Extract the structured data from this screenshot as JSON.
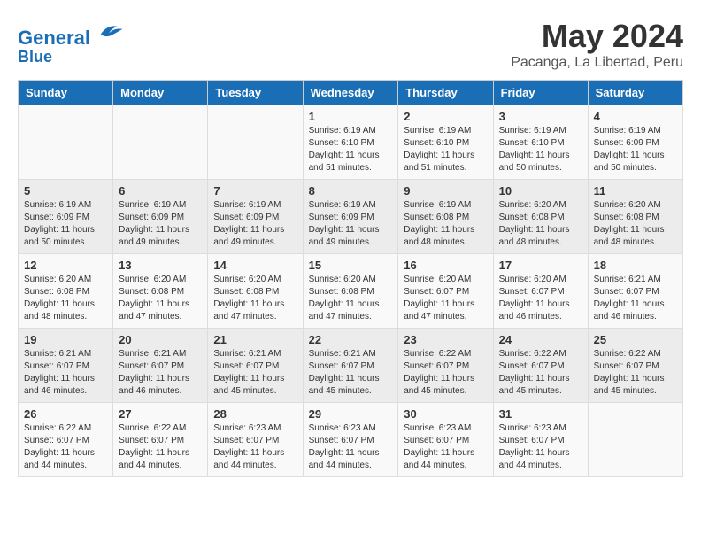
{
  "header": {
    "logo_line1": "General",
    "logo_line2": "Blue",
    "month_year": "May 2024",
    "location": "Pacanga, La Libertad, Peru"
  },
  "days_of_week": [
    "Sunday",
    "Monday",
    "Tuesday",
    "Wednesday",
    "Thursday",
    "Friday",
    "Saturday"
  ],
  "weeks": [
    [
      {
        "day": "",
        "info": ""
      },
      {
        "day": "",
        "info": ""
      },
      {
        "day": "",
        "info": ""
      },
      {
        "day": "1",
        "info": "Sunrise: 6:19 AM\nSunset: 6:10 PM\nDaylight: 11 hours\nand 51 minutes."
      },
      {
        "day": "2",
        "info": "Sunrise: 6:19 AM\nSunset: 6:10 PM\nDaylight: 11 hours\nand 51 minutes."
      },
      {
        "day": "3",
        "info": "Sunrise: 6:19 AM\nSunset: 6:10 PM\nDaylight: 11 hours\nand 50 minutes."
      },
      {
        "day": "4",
        "info": "Sunrise: 6:19 AM\nSunset: 6:09 PM\nDaylight: 11 hours\nand 50 minutes."
      }
    ],
    [
      {
        "day": "5",
        "info": "Sunrise: 6:19 AM\nSunset: 6:09 PM\nDaylight: 11 hours\nand 50 minutes."
      },
      {
        "day": "6",
        "info": "Sunrise: 6:19 AM\nSunset: 6:09 PM\nDaylight: 11 hours\nand 49 minutes."
      },
      {
        "day": "7",
        "info": "Sunrise: 6:19 AM\nSunset: 6:09 PM\nDaylight: 11 hours\nand 49 minutes."
      },
      {
        "day": "8",
        "info": "Sunrise: 6:19 AM\nSunset: 6:09 PM\nDaylight: 11 hours\nand 49 minutes."
      },
      {
        "day": "9",
        "info": "Sunrise: 6:19 AM\nSunset: 6:08 PM\nDaylight: 11 hours\nand 48 minutes."
      },
      {
        "day": "10",
        "info": "Sunrise: 6:20 AM\nSunset: 6:08 PM\nDaylight: 11 hours\nand 48 minutes."
      },
      {
        "day": "11",
        "info": "Sunrise: 6:20 AM\nSunset: 6:08 PM\nDaylight: 11 hours\nand 48 minutes."
      }
    ],
    [
      {
        "day": "12",
        "info": "Sunrise: 6:20 AM\nSunset: 6:08 PM\nDaylight: 11 hours\nand 48 minutes."
      },
      {
        "day": "13",
        "info": "Sunrise: 6:20 AM\nSunset: 6:08 PM\nDaylight: 11 hours\nand 47 minutes."
      },
      {
        "day": "14",
        "info": "Sunrise: 6:20 AM\nSunset: 6:08 PM\nDaylight: 11 hours\nand 47 minutes."
      },
      {
        "day": "15",
        "info": "Sunrise: 6:20 AM\nSunset: 6:08 PM\nDaylight: 11 hours\nand 47 minutes."
      },
      {
        "day": "16",
        "info": "Sunrise: 6:20 AM\nSunset: 6:07 PM\nDaylight: 11 hours\nand 47 minutes."
      },
      {
        "day": "17",
        "info": "Sunrise: 6:20 AM\nSunset: 6:07 PM\nDaylight: 11 hours\nand 46 minutes."
      },
      {
        "day": "18",
        "info": "Sunrise: 6:21 AM\nSunset: 6:07 PM\nDaylight: 11 hours\nand 46 minutes."
      }
    ],
    [
      {
        "day": "19",
        "info": "Sunrise: 6:21 AM\nSunset: 6:07 PM\nDaylight: 11 hours\nand 46 minutes."
      },
      {
        "day": "20",
        "info": "Sunrise: 6:21 AM\nSunset: 6:07 PM\nDaylight: 11 hours\nand 46 minutes."
      },
      {
        "day": "21",
        "info": "Sunrise: 6:21 AM\nSunset: 6:07 PM\nDaylight: 11 hours\nand 45 minutes."
      },
      {
        "day": "22",
        "info": "Sunrise: 6:21 AM\nSunset: 6:07 PM\nDaylight: 11 hours\nand 45 minutes."
      },
      {
        "day": "23",
        "info": "Sunrise: 6:22 AM\nSunset: 6:07 PM\nDaylight: 11 hours\nand 45 minutes."
      },
      {
        "day": "24",
        "info": "Sunrise: 6:22 AM\nSunset: 6:07 PM\nDaylight: 11 hours\nand 45 minutes."
      },
      {
        "day": "25",
        "info": "Sunrise: 6:22 AM\nSunset: 6:07 PM\nDaylight: 11 hours\nand 45 minutes."
      }
    ],
    [
      {
        "day": "26",
        "info": "Sunrise: 6:22 AM\nSunset: 6:07 PM\nDaylight: 11 hours\nand 44 minutes."
      },
      {
        "day": "27",
        "info": "Sunrise: 6:22 AM\nSunset: 6:07 PM\nDaylight: 11 hours\nand 44 minutes."
      },
      {
        "day": "28",
        "info": "Sunrise: 6:23 AM\nSunset: 6:07 PM\nDaylight: 11 hours\nand 44 minutes."
      },
      {
        "day": "29",
        "info": "Sunrise: 6:23 AM\nSunset: 6:07 PM\nDaylight: 11 hours\nand 44 minutes."
      },
      {
        "day": "30",
        "info": "Sunrise: 6:23 AM\nSunset: 6:07 PM\nDaylight: 11 hours\nand 44 minutes."
      },
      {
        "day": "31",
        "info": "Sunrise: 6:23 AM\nSunset: 6:07 PM\nDaylight: 11 hours\nand 44 minutes."
      },
      {
        "day": "",
        "info": ""
      }
    ]
  ]
}
